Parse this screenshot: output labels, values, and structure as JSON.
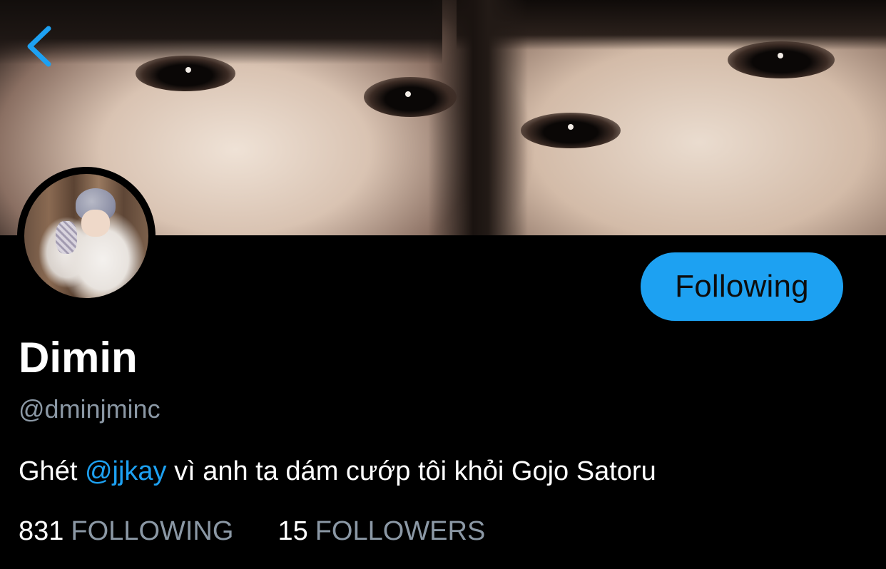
{
  "profile": {
    "display_name": "Dimin",
    "handle": "@dminjminc",
    "bio_prefix": "Ghét ",
    "bio_mention": "@jjkay",
    "bio_suffix": " vì anh ta dám cướp tôi khỏi Gojo Satoru"
  },
  "actions": {
    "follow_state_label": "Following"
  },
  "stats": {
    "following_count": "831",
    "following_label": "FOLLOWING",
    "followers_count": "15",
    "followers_label": "FOLLOWERS"
  },
  "icons": {
    "back": "chevron-left-icon"
  },
  "colors": {
    "accent": "#1da1f2",
    "background": "#000000",
    "muted_text": "#8b98a5",
    "primary_text": "#ffffff"
  }
}
